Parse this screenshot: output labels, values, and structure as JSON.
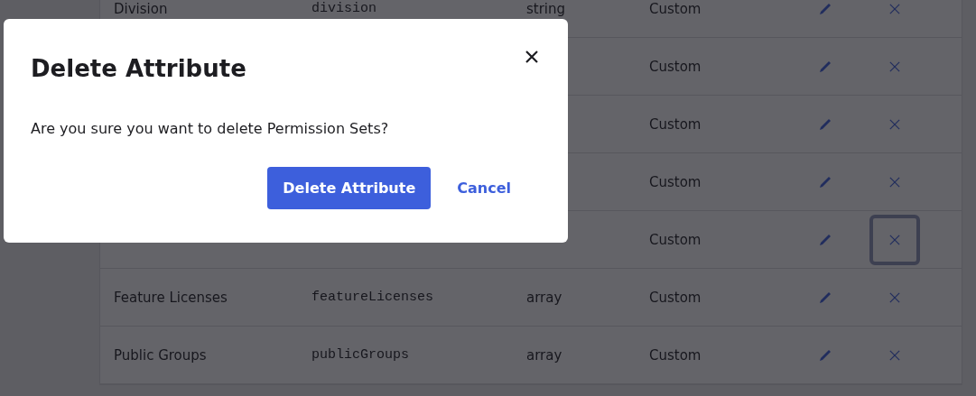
{
  "table": {
    "rows": [
      {
        "name": "Division",
        "key": "division",
        "type": "string",
        "source": "Custom",
        "delete_focused": false
      },
      {
        "source": "Custom",
        "delete_focused": false
      },
      {
        "source": "Custom",
        "delete_focused": false
      },
      {
        "source": "Custom",
        "delete_focused": false
      },
      {
        "source": "Custom",
        "delete_focused": true
      },
      {
        "name": "Feature Licenses",
        "key": "featureLicenses",
        "type": "array",
        "source": "Custom",
        "delete_focused": false
      },
      {
        "name": "Public Groups",
        "key": "publicGroups",
        "type": "array",
        "source": "Custom",
        "delete_focused": false
      }
    ]
  },
  "dialog": {
    "title": "Delete Attribute",
    "message": "Are you sure you want to delete Permission Sets?",
    "buttons": [
      {
        "kind": "primary",
        "label": "Delete Attribute"
      },
      {
        "kind": "link",
        "label": "Cancel"
      }
    ]
  }
}
